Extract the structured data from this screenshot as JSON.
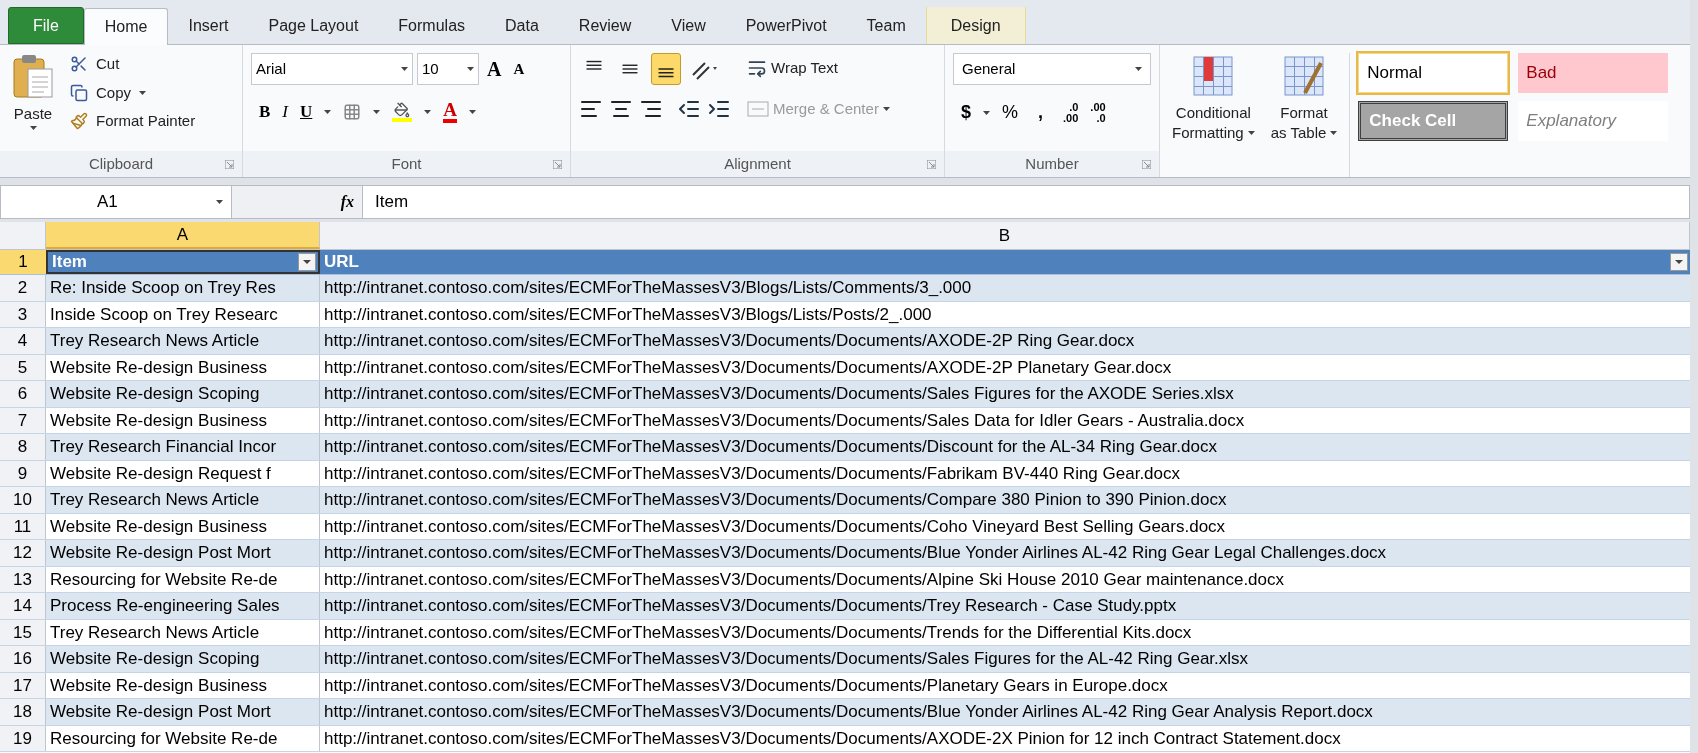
{
  "tabs": [
    {
      "label": "File",
      "kind": "file",
      "selected": false
    },
    {
      "label": "Home",
      "kind": "normal",
      "selected": true
    },
    {
      "label": "Insert",
      "kind": "normal",
      "selected": false
    },
    {
      "label": "Page Layout",
      "kind": "normal",
      "selected": false
    },
    {
      "label": "Formulas",
      "kind": "normal",
      "selected": false
    },
    {
      "label": "Data",
      "kind": "normal",
      "selected": false
    },
    {
      "label": "Review",
      "kind": "normal",
      "selected": false
    },
    {
      "label": "View",
      "kind": "normal",
      "selected": false
    },
    {
      "label": "PowerPivot",
      "kind": "normal",
      "selected": false
    },
    {
      "label": "Team",
      "kind": "normal",
      "selected": false
    },
    {
      "label": "Design",
      "kind": "contextual",
      "selected": false
    }
  ],
  "clipboard": {
    "group": "Clipboard",
    "paste": "Paste",
    "cut": "Cut",
    "copy": "Copy",
    "format_painter": "Format Painter"
  },
  "font": {
    "group": "Font",
    "family": "Arial",
    "size": "10",
    "grow": "A",
    "shrink": "A",
    "bold": "B",
    "italic": "I",
    "underline": "U",
    "font_color": "A"
  },
  "alignment": {
    "group": "Alignment",
    "vertical": [
      {
        "selected": false
      },
      {
        "selected": false
      },
      {
        "selected": true
      }
    ],
    "wrap_text": "Wrap Text",
    "merge_center": {
      "label": "Merge & Center",
      "disabled": true
    }
  },
  "number": {
    "group": "Number",
    "format": "General",
    "currency": "$",
    "percent": "%",
    "comma": ",",
    "increase_decimal": {
      "top": ".0",
      "bottom": ".00"
    },
    "decrease_decimal": {
      "top": ".00",
      "bottom": ".0"
    }
  },
  "styles": {
    "conditional": [
      "Conditional",
      "Formatting"
    ],
    "format_table": [
      "Format",
      "as Table"
    ],
    "cell_styles": [
      {
        "label": "Normal",
        "kind": "normal",
        "selected": true
      },
      {
        "label": "Bad",
        "kind": "bad",
        "selected": false
      },
      {
        "label": "Check Cell",
        "kind": "check",
        "selected": false
      },
      {
        "label": "Explanatory",
        "kind": "explanatory",
        "selected": false
      }
    ]
  },
  "formula_bar": {
    "name_box": "A1",
    "fx": "fx",
    "value": "Item"
  },
  "sheet": {
    "columns": [
      {
        "letter": "A",
        "selected": true
      },
      {
        "letter": "B",
        "selected": false
      }
    ],
    "header_row": {
      "number": "1",
      "selected": true,
      "cells": [
        "Item",
        "URL"
      ]
    },
    "rows": [
      {
        "number": "2",
        "selected": false,
        "item": "Re: Inside Scoop on Trey Res",
        "url": "http://intranet.contoso.com/sites/ECMForTheMassesV3/Blogs/Lists/Comments/3_.000"
      },
      {
        "number": "3",
        "selected": false,
        "item": "Inside Scoop on Trey Researc",
        "url": "http://intranet.contoso.com/sites/ECMForTheMassesV3/Blogs/Lists/Posts/2_.000"
      },
      {
        "number": "4",
        "selected": false,
        "item": "Trey Research News Article",
        "url": "http://intranet.contoso.com/sites/ECMForTheMassesV3/Documents/Documents/AXODE-2P Ring Gear.docx"
      },
      {
        "number": "5",
        "selected": false,
        "item": "Website Re-design Business",
        "url": "http://intranet.contoso.com/sites/ECMForTheMassesV3/Documents/Documents/AXODE-2P Planetary Gear.docx"
      },
      {
        "number": "6",
        "selected": false,
        "item": "Website Re-design Scoping",
        "url": "http://intranet.contoso.com/sites/ECMForTheMassesV3/Documents/Documents/Sales Figures for the AXODE Series.xlsx"
      },
      {
        "number": "7",
        "selected": false,
        "item": "Website Re-design Business",
        "url": "http://intranet.contoso.com/sites/ECMForTheMassesV3/Documents/Documents/Sales Data for Idler Gears - Australia.docx"
      },
      {
        "number": "8",
        "selected": false,
        "item": "Trey Research Financial Incor",
        "url": "http://intranet.contoso.com/sites/ECMForTheMassesV3/Documents/Documents/Discount for the AL-34 Ring Gear.docx"
      },
      {
        "number": "9",
        "selected": false,
        "item": "Website Re-design Request f",
        "url": "http://intranet.contoso.com/sites/ECMForTheMassesV3/Documents/Documents/Fabrikam BV-440 Ring Gear.docx"
      },
      {
        "number": "10",
        "selected": false,
        "item": "Trey Research News Article",
        "url": "http://intranet.contoso.com/sites/ECMForTheMassesV3/Documents/Documents/Compare 380 Pinion to 390 Pinion.docx"
      },
      {
        "number": "11",
        "selected": false,
        "item": "Website Re-design Business",
        "url": "http://intranet.contoso.com/sites/ECMForTheMassesV3/Documents/Documents/Coho Vineyard Best Selling Gears.docx"
      },
      {
        "number": "12",
        "selected": false,
        "item": "Website Re-design Post Mort",
        "url": "http://intranet.contoso.com/sites/ECMForTheMassesV3/Documents/Documents/Blue Yonder Airlines AL-42 Ring Gear Legal Challenges.docx"
      },
      {
        "number": "13",
        "selected": false,
        "item": "Resourcing for Website Re-de",
        "url": "http://intranet.contoso.com/sites/ECMForTheMassesV3/Documents/Documents/Alpine Ski House 2010 Gear maintenance.docx"
      },
      {
        "number": "14",
        "selected": false,
        "item": "Process Re-engineering Sales",
        "url": "http://intranet.contoso.com/sites/ECMForTheMassesV3/Documents/Documents/Trey Research - Case Study.pptx"
      },
      {
        "number": "15",
        "selected": false,
        "item": "Trey Research News Article",
        "url": "http://intranet.contoso.com/sites/ECMForTheMassesV3/Documents/Documents/Trends for the Differential Kits.docx"
      },
      {
        "number": "16",
        "selected": false,
        "item": "Website Re-design Scoping",
        "url": "http://intranet.contoso.com/sites/ECMForTheMassesV3/Documents/Documents/Sales Figures for the AL-42 Ring Gear.xlsx"
      },
      {
        "number": "17",
        "selected": false,
        "item": "Website Re-design Business",
        "url": "http://intranet.contoso.com/sites/ECMForTheMassesV3/Documents/Documents/Planetary Gears in Europe.docx"
      },
      {
        "number": "18",
        "selected": false,
        "item": "Website Re-design Post Mort",
        "url": "http://intranet.contoso.com/sites/ECMForTheMassesV3/Documents/Documents/Blue Yonder Airlines AL-42 Ring Gear Analysis Report.docx"
      },
      {
        "number": "19",
        "selected": false,
        "item": "Resourcing for Website Re-de",
        "url": "http://intranet.contoso.com/sites/ECMForTheMassesV3/Documents/Documents/AXODE-2X Pinion for 12 inch Contract Statement.docx"
      }
    ]
  }
}
